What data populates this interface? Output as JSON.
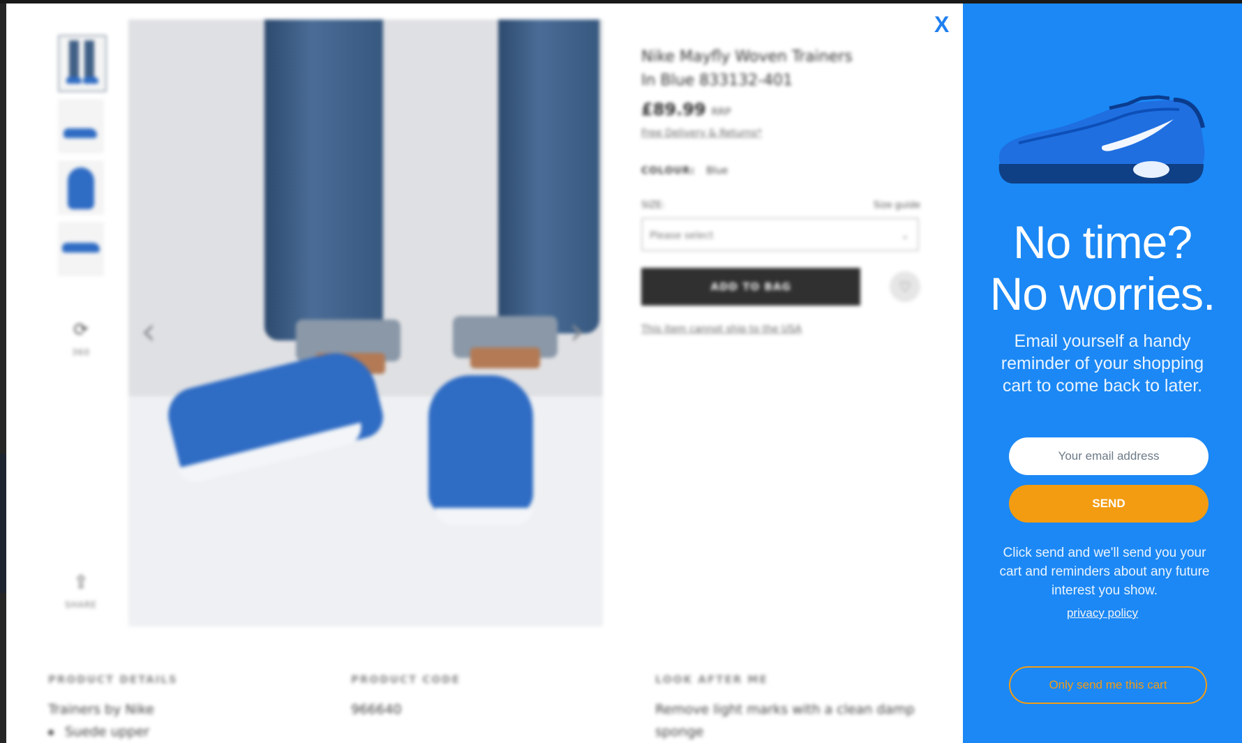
{
  "product_page": {
    "title_line1": "Nike Mayfly Woven Trainers",
    "title_line2": "In Blue 833132-401",
    "price": "£89.99",
    "price_note": "RRP",
    "delivery_link": "Free Delivery & Returns*",
    "colour_label": "COLOUR:",
    "colour_value": "Blue",
    "size_label": "SIZE:",
    "size_guide": "Size guide",
    "size_placeholder": "Please select",
    "add_to_bag": "ADD TO BAG",
    "ship_note": "This item cannot ship to the USA",
    "thumb_icon_360_label": "360",
    "thumb_icon_share_label": "SHARE",
    "details": [
      {
        "heading": "PRODUCT DETAILS",
        "line1": "Trainers by Nike",
        "line2": "Suede upper"
      },
      {
        "heading": "PRODUCT CODE",
        "line1": "966640",
        "line2": ""
      },
      {
        "heading": "LOOK AFTER ME",
        "line1": "Remove light marks with a clean damp",
        "line2": "sponge"
      }
    ]
  },
  "close_button": "X",
  "panel": {
    "headline_line1": "No time?",
    "headline_line2": "No worries.",
    "subtext": "Email yourself a handy reminder of your shopping cart to come back to later.",
    "email_placeholder": "Your email address",
    "send_label": "SEND",
    "explain": "Click send and we'll send you your cart and reminders about any future interest you show.",
    "privacy_label": "privacy policy",
    "only_cart_label": "Only send me this cart"
  },
  "colors": {
    "panel_bg": "#1b88f5",
    "send_button": "#f39c12",
    "close_x": "#1f7ff0"
  },
  "icons": [
    "close-icon",
    "chevron-left-icon",
    "chevron-right-icon",
    "heart-icon",
    "rotate-360-icon",
    "share-icon",
    "chevron-down-icon"
  ]
}
